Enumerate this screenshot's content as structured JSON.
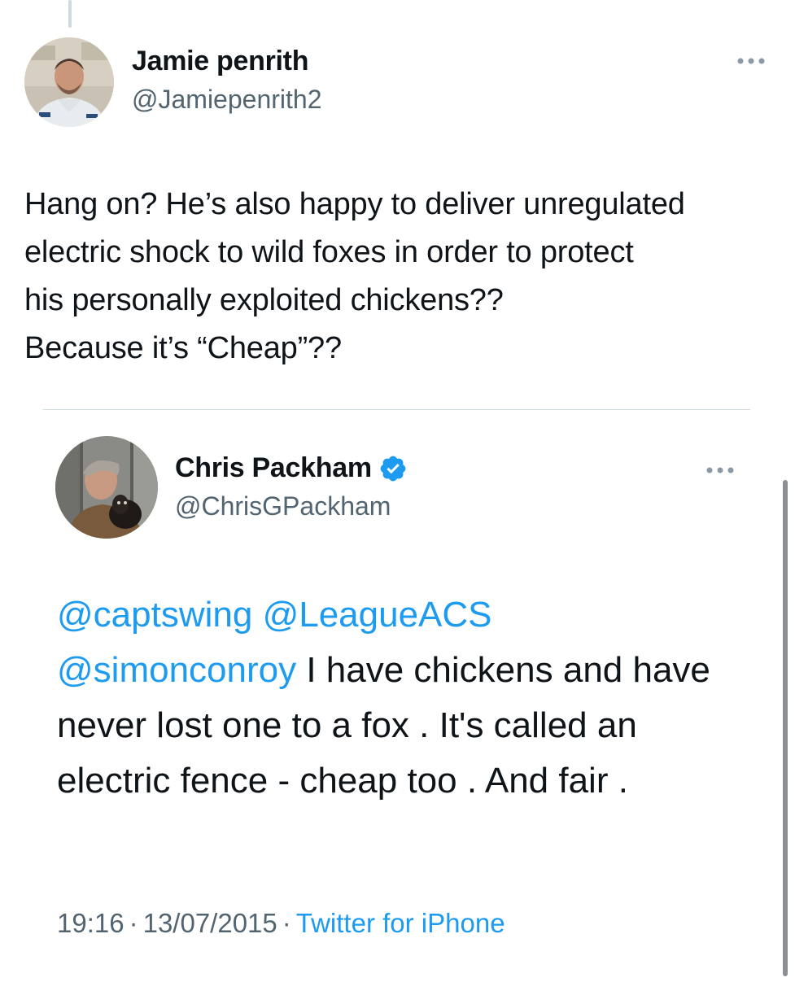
{
  "outer_tweet": {
    "display_name": "Jamie penrith",
    "handle": "@Jamiepenrith2",
    "text": "Hang on? He’s also happy to deliver unregulated\nelectric shock to wild foxes in order to protect\nhis personally exploited chickens??\nBecause it’s “Cheap”??",
    "more_icon": "more-dots-icon"
  },
  "quoted_tweet": {
    "display_name": "Chris Packham",
    "handle": "@ChrisGPackham",
    "verified_icon": "verified-badge-icon",
    "more_icon": "more-dots-icon",
    "mentions": [
      "@captswing",
      "@LeagueACS",
      "@simonconroy"
    ],
    "body": "I have chickens and have never lost one to a fox . It's called an electric fence - cheap too . And fair .",
    "time": "19:16",
    "date": "13/07/2015",
    "separator": "·",
    "source": "Twitter for iPhone"
  },
  "colors": {
    "link": "#1d9bf0",
    "secondary_text": "#536471",
    "border": "#cfd9de",
    "primary_text": "#0f1419"
  }
}
